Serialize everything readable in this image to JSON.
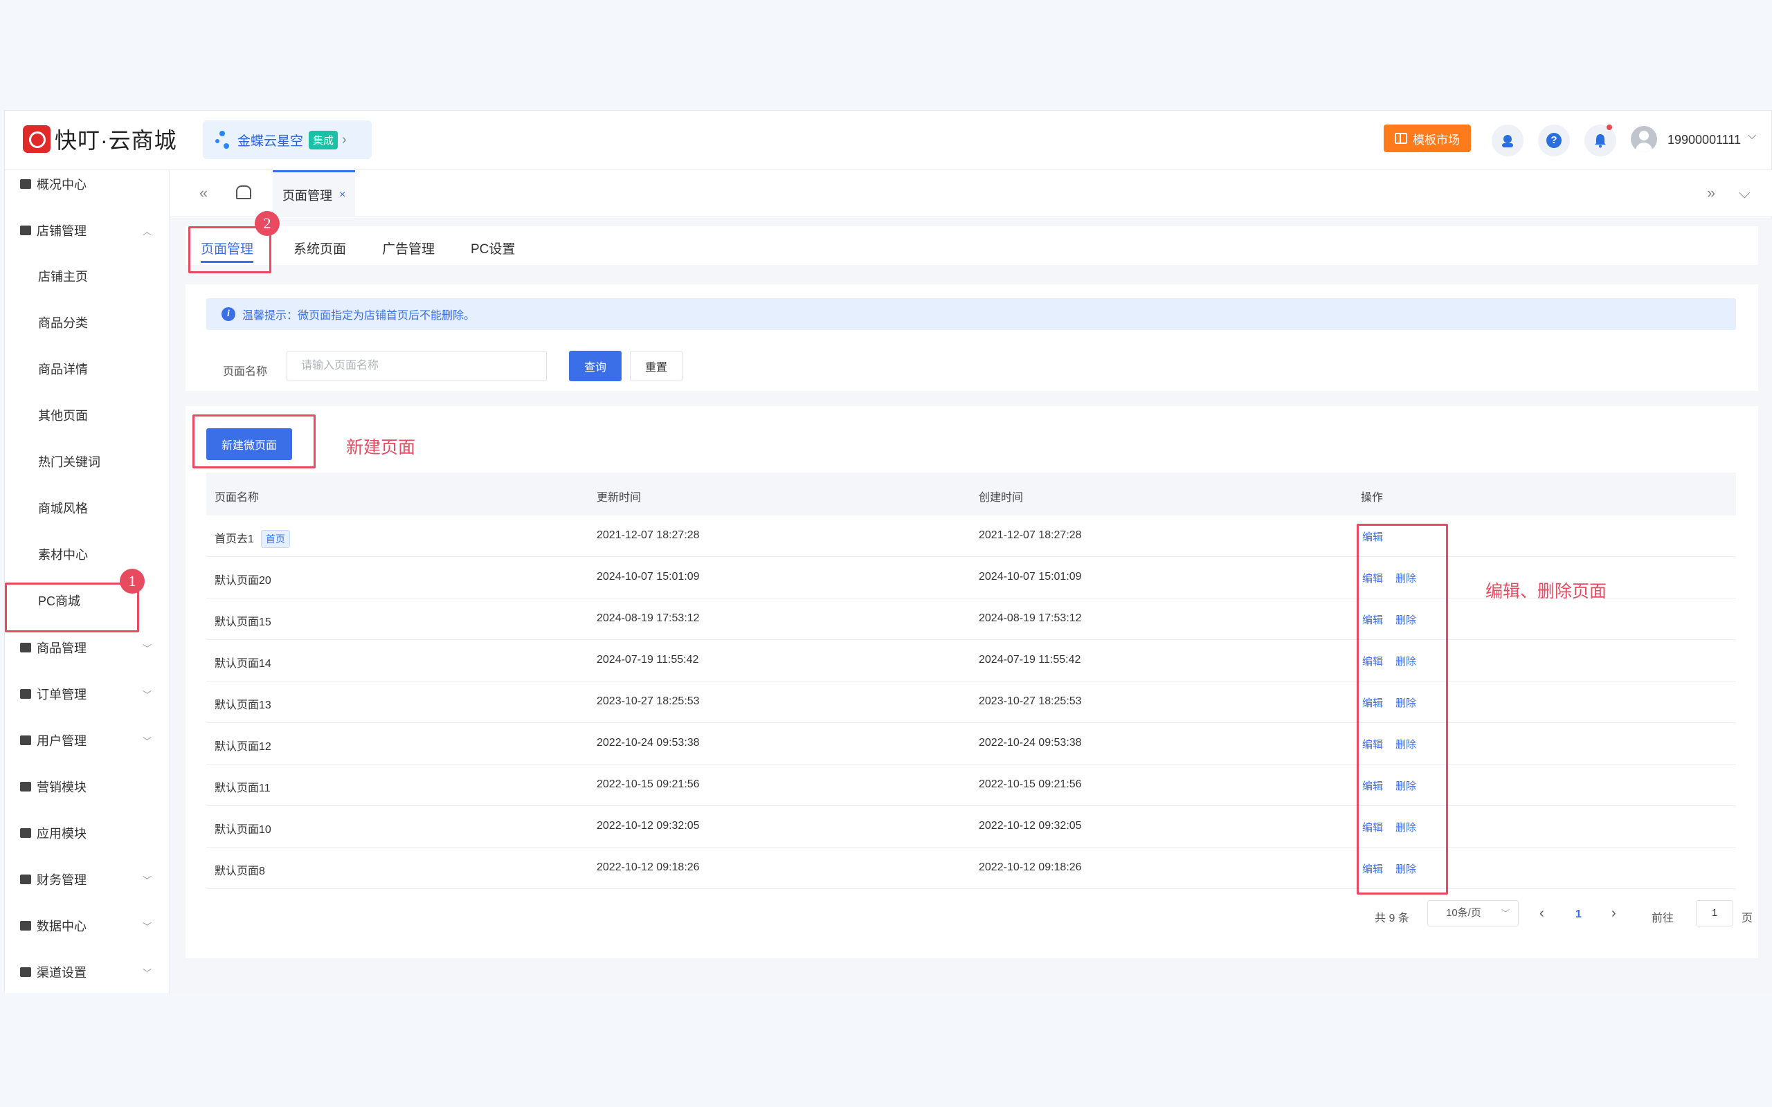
{
  "header": {
    "logo_text": "快叮·云商城",
    "store_name": "金蝶云星空",
    "store_badge": "集成",
    "template_market": "模板市场",
    "help_glyph": "?",
    "user_phone": "19900001111",
    "user_caret": "⌵"
  },
  "sidebar": {
    "items": [
      {
        "label": "概况中心",
        "icon": "dashboard-icon"
      },
      {
        "label": "店铺管理",
        "icon": "store-icon",
        "expanded": true
      },
      {
        "label": "商品管理",
        "icon": "goods-icon"
      },
      {
        "label": "订单管理",
        "icon": "order-icon"
      },
      {
        "label": "用户管理",
        "icon": "user-icon"
      },
      {
        "label": "营销模块",
        "icon": "marketing-icon"
      },
      {
        "label": "应用模块",
        "icon": "apps-icon"
      },
      {
        "label": "财务管理",
        "icon": "finance-icon"
      },
      {
        "label": "数据中心",
        "icon": "data-icon"
      },
      {
        "label": "渠道设置",
        "icon": "channel-icon"
      }
    ],
    "sub_items": [
      "店铺主页",
      "商品分类",
      "商品详情",
      "其他页面",
      "热门关键词",
      "商城风格",
      "素材中心",
      "PC商城"
    ],
    "caret_up": "︿",
    "caret_down": "﹀"
  },
  "tabbar": {
    "collapse_glyph": "«",
    "expand_glyph": "»",
    "menu_glyph": "⌵",
    "active_tab": "页面管理",
    "close_glyph": "×"
  },
  "subtabs": [
    "页面管理",
    "系统页面",
    "广告管理",
    "PC设置"
  ],
  "filter": {
    "tip_icon": "i",
    "tip": "温馨提示：微页面指定为店铺首页后不能删除。",
    "label": "页面名称",
    "placeholder": "请输入页面名称",
    "query": "查询",
    "reset": "重置"
  },
  "annotations": {
    "step1": "1",
    "step2": "2",
    "new_page": "新建页面",
    "edit_delete": "编辑、删除页面"
  },
  "table": {
    "new_button": "新建微页面",
    "columns": [
      "页面名称",
      "更新时间",
      "创建时间",
      "操作"
    ],
    "rows": [
      {
        "name": "首页去1",
        "tag": "首页",
        "updated": "2021-12-07 18:27:28",
        "created": "2021-12-07 18:27:28",
        "edit": "编辑",
        "delete": ""
      },
      {
        "name": "默认页面20",
        "tag": "",
        "updated": "2024-10-07 15:01:09",
        "created": "2024-10-07 15:01:09",
        "edit": "编辑",
        "delete": "删除"
      },
      {
        "name": "默认页面15",
        "tag": "",
        "updated": "2024-08-19 17:53:12",
        "created": "2024-08-19 17:53:12",
        "edit": "编辑",
        "delete": "删除"
      },
      {
        "name": "默认页面14",
        "tag": "",
        "updated": "2024-07-19 11:55:42",
        "created": "2024-07-19 11:55:42",
        "edit": "编辑",
        "delete": "删除"
      },
      {
        "name": "默认页面13",
        "tag": "",
        "updated": "2023-10-27 18:25:53",
        "created": "2023-10-27 18:25:53",
        "edit": "编辑",
        "delete": "删除"
      },
      {
        "name": "默认页面12",
        "tag": "",
        "updated": "2022-10-24 09:53:38",
        "created": "2022-10-24 09:53:38",
        "edit": "编辑",
        "delete": "删除"
      },
      {
        "name": "默认页面11",
        "tag": "",
        "updated": "2022-10-15 09:21:56",
        "created": "2022-10-15 09:21:56",
        "edit": "编辑",
        "delete": "删除"
      },
      {
        "name": "默认页面10",
        "tag": "",
        "updated": "2022-10-12 09:32:05",
        "created": "2022-10-12 09:32:05",
        "edit": "编辑",
        "delete": "删除"
      },
      {
        "name": "默认页面8",
        "tag": "",
        "updated": "2022-10-12 09:18:26",
        "created": "2022-10-12 09:18:26",
        "edit": "编辑",
        "delete": "删除"
      }
    ]
  },
  "pagination": {
    "total": "共 9 条",
    "page_size": "10条/页",
    "prev_glyph": "‹",
    "next_glyph": "›",
    "current": "1",
    "goto": "前往",
    "goto_value": "1",
    "page_unit": "页"
  }
}
